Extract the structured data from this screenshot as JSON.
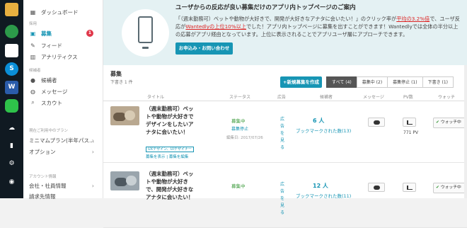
{
  "sidebar": {
    "items": [
      {
        "name": "dashboard",
        "icon": "grid-icon",
        "label": "ダッシュボード"
      },
      {
        "name": "recruit",
        "icon": "recruit-icon",
        "label": "募集",
        "badge": "1"
      },
      {
        "name": "feed",
        "icon": "feed-icon",
        "label": "フィード"
      },
      {
        "name": "analytics",
        "icon": "chart-icon",
        "label": "アナリティクス"
      },
      {
        "name": "candidates",
        "icon": "person-icon",
        "label": "候補者"
      },
      {
        "name": "messages",
        "icon": "chat-icon",
        "label": "メッセージ"
      },
      {
        "name": "scout",
        "icon": "search-icon",
        "label": "スカウト"
      }
    ],
    "heading_recruit": "採用",
    "heading_candidates": "候補者",
    "heading_plan": "現在ご利用中のプラン",
    "plan_label": "ミニマムプラン(半年パス...",
    "options_label": "オプション",
    "heading_account": "アカウント情報",
    "company_label": "会社・社員情報",
    "billing_label": "請求先情報"
  },
  "banner": {
    "title": "ユーザからの反応が良い募集だけのアプリ内トップページのご案内",
    "text_part1": "「（週末勤務可）ペットや動物が大好きで、開発が大好きなアナタに会いたい！」のクリック率が",
    "highlight1": "平均の3.2%倍",
    "text_part2": "で、ユーザ反応が",
    "highlight2": "Wantedlyの上位10%以上",
    "text_part3": "でした！アプリ内トップページに募集を出すことができます！Wantedlyでは全体の半分以上の応募がアプリ経由となっています。上位に表示されることでアプリユーザ層にアプローチできます。",
    "button": "お申込み・お問い合わせ"
  },
  "main": {
    "title": "募集",
    "subtitle": "下書き 1 件",
    "new_button": "+新規募集を作成",
    "tabs": [
      "すべて (4)",
      "募集中 (2)",
      "募集停止 (1)",
      "下書き (1)"
    ],
    "columns": {
      "title": "タイトル",
      "status": "ステータス",
      "ad": "広告",
      "candidates": "候補者",
      "message": "メッセージ",
      "pv": "PV数",
      "watch": "ウォッチ"
    },
    "rows": [
      {
        "title": "（週末勤務可）ペットや動物が大好きでデザインをしたいアナタに会いたい！",
        "tags": "UXデザイン、UIデザイナー",
        "links": "募集を表示 | 募集を編集",
        "status": "募集中",
        "status_action": "募集停止",
        "date": "編集日: 2017/07/26",
        "ad": "広告を見る",
        "candidates": "6 人",
        "bookmarks": "ブックマークされた数(13)",
        "pv": "771 PV",
        "watch": "ウォッチ中"
      },
      {
        "title": "（週末勤務可）ペットや動物が大好きで、開発が大好きなアナタに会いたい！",
        "status": "募集中",
        "ad": "広告を見る",
        "candidates": "12 人",
        "bookmarks": "ブックマークされた数(11)",
        "watch": "ウォッチ中"
      }
    ]
  }
}
